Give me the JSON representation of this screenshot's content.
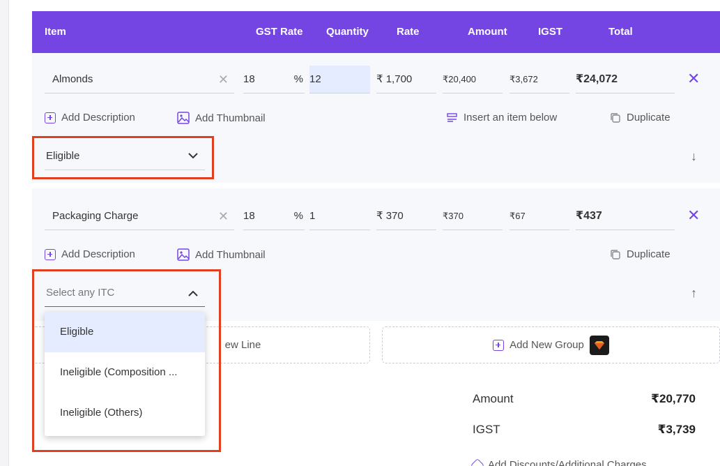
{
  "header": {
    "item": "Item",
    "gst_rate": "GST Rate",
    "quantity": "Quantity",
    "rate": "Rate",
    "amount": "Amount",
    "igst": "IGST",
    "total": "Total"
  },
  "rows": [
    {
      "item": "Almonds",
      "gst_rate": "18",
      "percent": "%",
      "quantity": "12",
      "rate": "₹ 1,700",
      "amount": "₹20,400",
      "igst": "₹3,672",
      "total": "₹24,072",
      "add_description": "Add Description",
      "add_thumbnail": "Add Thumbnail",
      "insert_below": "Insert an item below",
      "duplicate": "Duplicate",
      "itc_value": "Eligible"
    },
    {
      "item": "Packaging Charge",
      "gst_rate": "18",
      "percent": "%",
      "quantity": "1",
      "rate": "₹ 370",
      "amount": "₹370",
      "igst": "₹67",
      "total": "₹437",
      "add_description": "Add Description",
      "add_thumbnail": "Add Thumbnail",
      "duplicate": "Duplicate",
      "itc_placeholder": "Select any ITC"
    }
  ],
  "itc_options": [
    "Eligible",
    "Ineligible (Composition ...",
    "Ineligible (Others)"
  ],
  "actions": {
    "add_new_line_partial": "ew Line",
    "add_new_group": "Add New Group"
  },
  "summary": {
    "amount_label": "Amount",
    "amount_value": "₹20,770",
    "igst_label": "IGST",
    "igst_value": "₹3,739",
    "discounts_partial": "Add Discounts/Additional Charges"
  },
  "colors": {
    "header_bg": "#7445e3",
    "accent": "#7445e3",
    "highlight_border": "#e0401f",
    "selected_option_bg": "#e5ecff"
  }
}
